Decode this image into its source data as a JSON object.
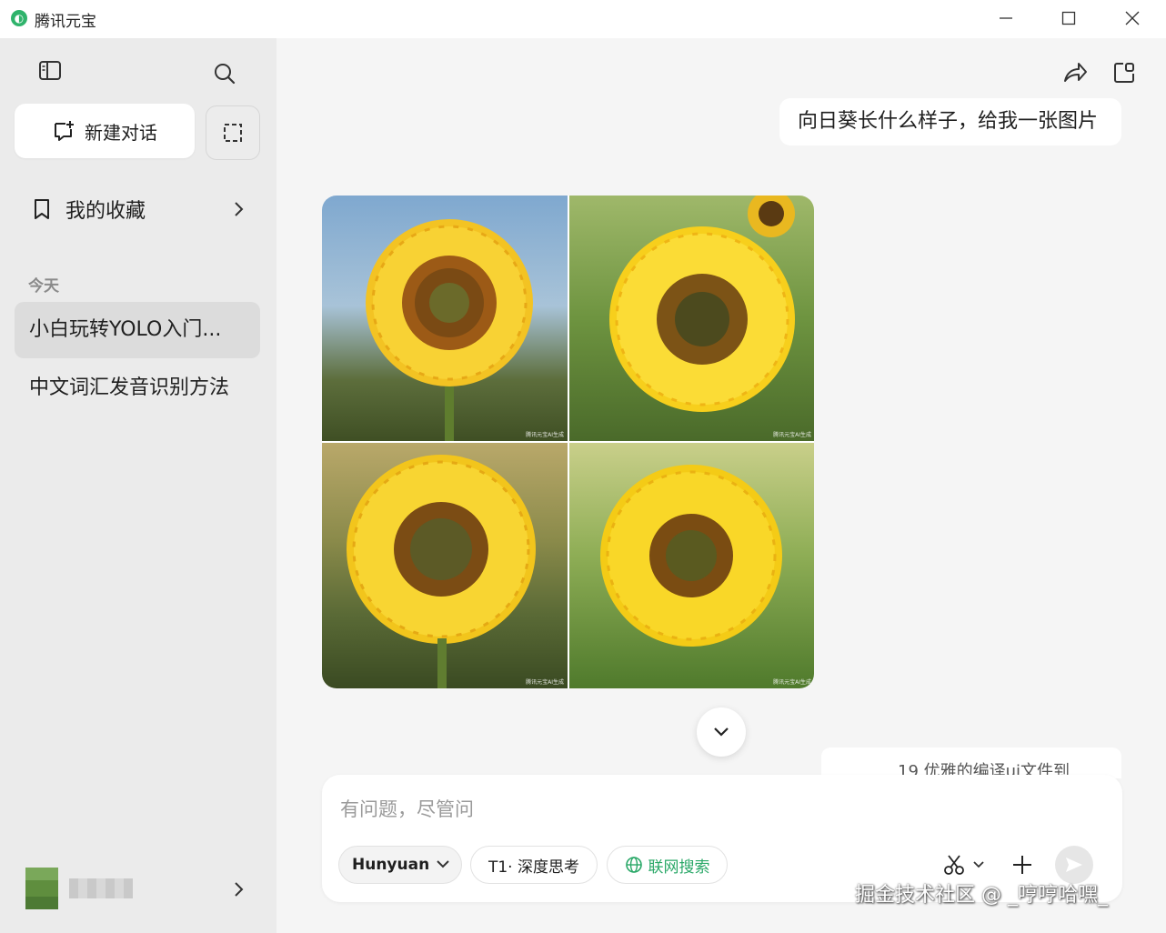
{
  "window": {
    "app_title": "腾讯元宝",
    "logo_glyph": "◐"
  },
  "sidebar": {
    "new_chat_label": "新建对话",
    "favorites_label": "我的收藏",
    "section_today": "今天",
    "conversations": [
      {
        "title": "小白玩转YOLO入门...",
        "active": true
      },
      {
        "title": "中文词汇发音识别方法",
        "active": false
      }
    ],
    "user": {
      "name": "■■■■"
    }
  },
  "chat": {
    "user_message": "向日葵长什么样子，给我一张图片",
    "generated_images": [
      {
        "label": "sunflower-1",
        "watermark": "腾讯元宝AI生成"
      },
      {
        "label": "sunflower-2",
        "watermark": "腾讯元宝AI生成"
      },
      {
        "label": "sunflower-3",
        "watermark": "腾讯元宝AI生成"
      },
      {
        "label": "sunflower-4",
        "watermark": "腾讯元宝AI生成"
      }
    ],
    "hint_card_text": "19 优雅的编译ui文件到"
  },
  "composer": {
    "placeholder": "有问题，尽管问",
    "model_label": "Hunyuan",
    "think_label": "T1· 深度思考",
    "search_label": "联网搜索"
  },
  "overlay": {
    "watermark_text": "掘金技术社区 @ _哼哼哈嘿_"
  },
  "colors": {
    "accent_green": "#2aa868",
    "sidebar_bg": "#ebebeb",
    "main_bg": "#f5f5f5"
  }
}
